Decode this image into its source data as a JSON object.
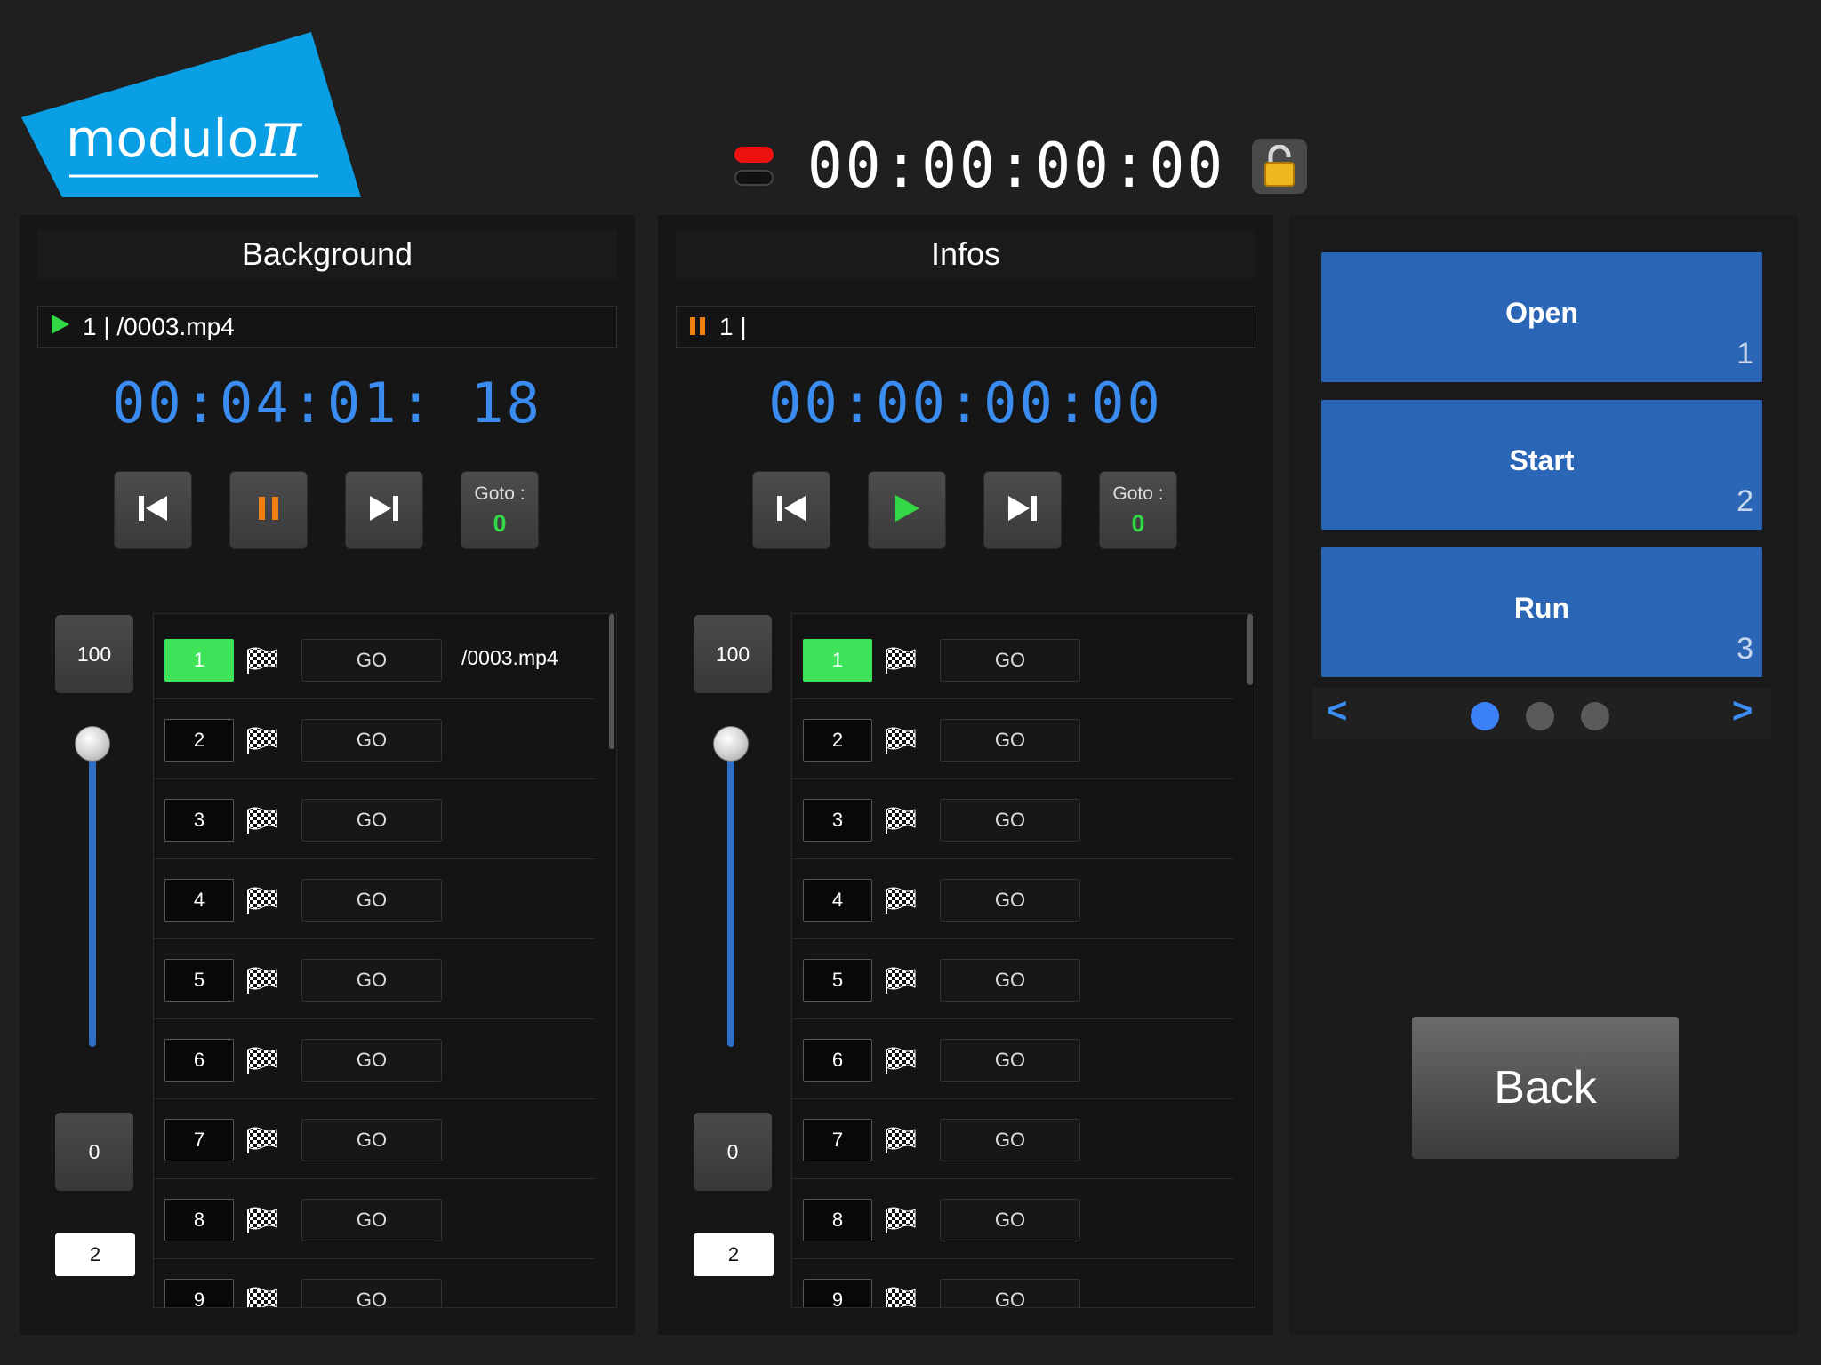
{
  "logo": {
    "text": "modulo",
    "symbol": "π",
    "color": "#0a9ee4"
  },
  "header": {
    "timecode": "00:00:00:00",
    "record_icon": "record-indicator-icon",
    "lock_icon": "unlocked-padlock-icon"
  },
  "panels": [
    {
      "title": "Background",
      "status": {
        "state": "playing",
        "icon": "play-icon",
        "text": "1 |   /0003.mp4"
      },
      "timecode": "00:04:01: 18",
      "transport": {
        "prev_icon": "skip-previous-icon",
        "main_icon": "pause-icon",
        "main_state": "pause",
        "next_icon": "skip-next-icon",
        "goto_label": "Goto :",
        "goto_value": "0"
      },
      "volume": {
        "max_label": "100",
        "min_label": "0",
        "level": 1.0,
        "layer": "2"
      },
      "cues": [
        {
          "num": "1",
          "go": "GO",
          "file": "/0003.mp4",
          "active": true
        },
        {
          "num": "2",
          "go": "GO",
          "file": ""
        },
        {
          "num": "3",
          "go": "GO",
          "file": ""
        },
        {
          "num": "4",
          "go": "GO",
          "file": ""
        },
        {
          "num": "5",
          "go": "GO",
          "file": ""
        },
        {
          "num": "6",
          "go": "GO",
          "file": ""
        },
        {
          "num": "7",
          "go": "GO",
          "file": ""
        },
        {
          "num": "8",
          "go": "GO",
          "file": ""
        },
        {
          "num": "9",
          "go": "GO",
          "file": ""
        }
      ]
    },
    {
      "title": "Infos",
      "status": {
        "state": "paused",
        "icon": "pause-icon",
        "text": "1 |"
      },
      "timecode": "00:00:00:00",
      "transport": {
        "prev_icon": "skip-previous-icon",
        "main_icon": "play-icon",
        "main_state": "play",
        "next_icon": "skip-next-icon",
        "goto_label": "Goto :",
        "goto_value": "0"
      },
      "volume": {
        "max_label": "100",
        "min_label": "0",
        "level": 1.0,
        "layer": "2"
      },
      "cues": [
        {
          "num": "1",
          "go": "GO",
          "file": "",
          "active": true
        },
        {
          "num": "2",
          "go": "GO",
          "file": ""
        },
        {
          "num": "3",
          "go": "GO",
          "file": ""
        },
        {
          "num": "4",
          "go": "GO",
          "file": ""
        },
        {
          "num": "5",
          "go": "GO",
          "file": ""
        },
        {
          "num": "6",
          "go": "GO",
          "file": ""
        },
        {
          "num": "7",
          "go": "GO",
          "file": ""
        },
        {
          "num": "8",
          "go": "GO",
          "file": ""
        },
        {
          "num": "9",
          "go": "GO",
          "file": ""
        }
      ]
    }
  ],
  "actions": [
    {
      "label": "Open",
      "num": "1"
    },
    {
      "label": "Start",
      "num": "2"
    },
    {
      "label": "Run",
      "num": "3"
    }
  ],
  "pager": {
    "prev": "<",
    "next": ">",
    "pages": 3,
    "current": 1
  },
  "back_label": "Back",
  "colors": {
    "accent": "#3a8cf0",
    "action_button": "#2b65b5",
    "active_cue": "#3ee35a",
    "pause": "#f07f10",
    "play": "#32d846"
  }
}
